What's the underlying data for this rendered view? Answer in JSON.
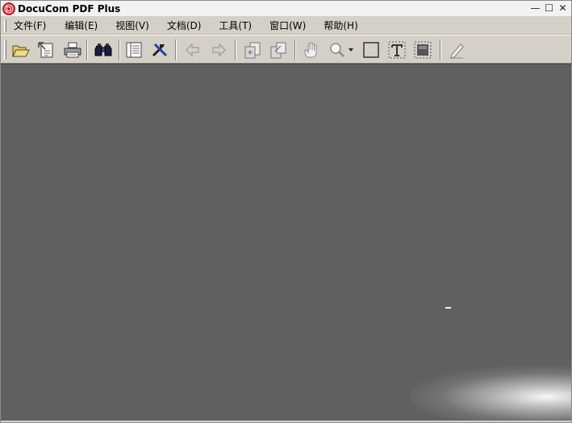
{
  "window": {
    "title": "DocuCom PDF Plus",
    "controls": {
      "minimize": "—",
      "maximize": "☐",
      "close": "✕"
    }
  },
  "menubar": {
    "items": [
      {
        "label": "文件(F)"
      },
      {
        "label": "编辑(E)"
      },
      {
        "label": "视图(V)"
      },
      {
        "label": "文档(D)"
      },
      {
        "label": "工具(T)"
      },
      {
        "label": "窗口(W)"
      },
      {
        "label": "帮助(H)"
      }
    ]
  },
  "toolbar": {
    "buttons": [
      {
        "icon": "open-folder-icon"
      },
      {
        "icon": "properties-icon"
      },
      {
        "icon": "print-icon"
      },
      {
        "icon": "find-binoculars-icon"
      },
      {
        "icon": "page-view-icon"
      },
      {
        "icon": "tools-icon"
      },
      {
        "icon": "back-arrow-icon"
      },
      {
        "icon": "forward-arrow-icon"
      },
      {
        "icon": "insert-page-icon"
      },
      {
        "icon": "extract-page-icon"
      },
      {
        "icon": "hand-icon"
      },
      {
        "icon": "zoom-icon"
      },
      {
        "icon": "rectangle-icon"
      },
      {
        "icon": "text-box-icon"
      },
      {
        "icon": "image-select-icon"
      },
      {
        "icon": "pen-icon"
      }
    ]
  },
  "colors": {
    "document_background": "#606060",
    "chrome": "#d4d0c8",
    "app_icon": "#c0202a"
  }
}
